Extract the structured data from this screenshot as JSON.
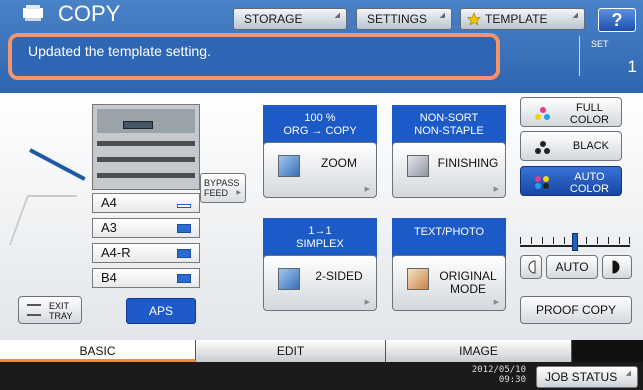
{
  "header": {
    "title": "COPY",
    "storage_label": "STORAGE",
    "settings_label": "SETTINGS",
    "template_label": "TEMPLATE",
    "help_label": "?"
  },
  "message": {
    "text": "Updated the template setting.",
    "set_label": "SET",
    "set_value": "1"
  },
  "paper": {
    "bypass_label_1": "BYPASS",
    "bypass_label_2": "FEED",
    "trays": [
      "A4",
      "A3",
      "A4-R",
      "B4"
    ],
    "exit_label_1": "EXIT",
    "exit_label_2": "TRAY",
    "aps_label": "APS"
  },
  "functions": {
    "zoom_status_1": "100 %",
    "zoom_status_2": "ORG → COPY",
    "zoom_label": "ZOOM",
    "finishing_status_1": "NON-SORT",
    "finishing_status_2": "NON-STAPLE",
    "finishing_label": "FINISHING",
    "duplex_status_1": "1→1",
    "duplex_status_2": "SIMPLEX",
    "duplex_label": "2-SIDED",
    "mode_status": "TEXT/PHOTO",
    "mode_label_1": "ORIGINAL",
    "mode_label_2": "MODE"
  },
  "color": {
    "full_1": "FULL",
    "full_2": "COLOR",
    "black": "BLACK",
    "auto_1": "AUTO",
    "auto_2": "COLOR",
    "density_auto": "AUTO",
    "density_level": 0.5,
    "proof_copy": "PROOF COPY"
  },
  "tabs": [
    "BASIC",
    "EDIT",
    "IMAGE"
  ],
  "footer": {
    "date": "2012/05/10",
    "time": "09:30",
    "job_status": "JOB STATUS"
  },
  "colors": {
    "header_blue": "#3a72bf",
    "accent_orange": "#f08a3c",
    "selected_blue": "#1e5bc8"
  }
}
